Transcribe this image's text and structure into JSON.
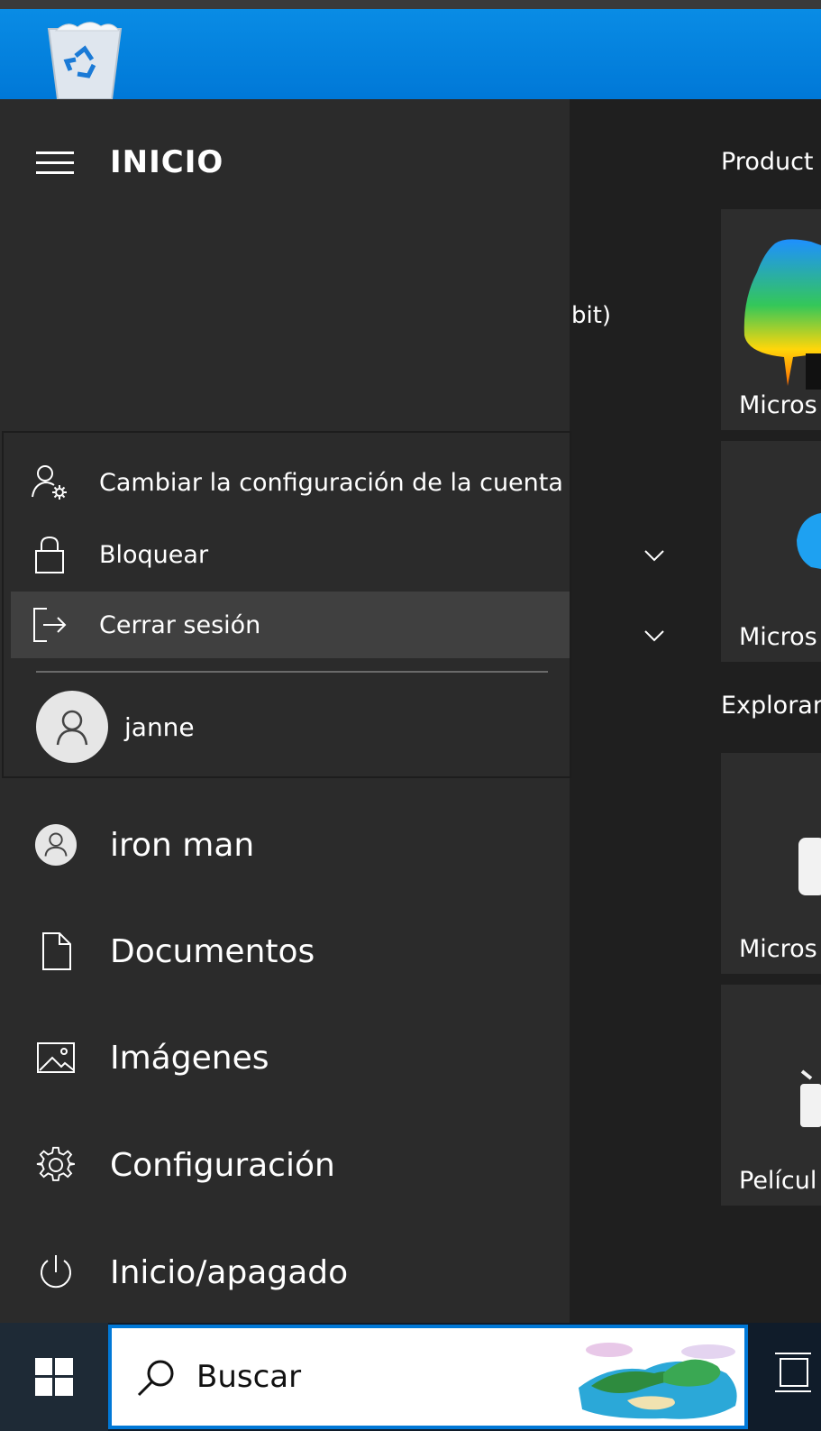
{
  "start": {
    "title": "INICIO",
    "partial_app_text": "bit)"
  },
  "account_flyout": {
    "items": [
      {
        "label": "Cambiar la configuración de la cuenta",
        "icon": "account-settings-icon"
      },
      {
        "label": "Bloquear",
        "icon": "lock-icon"
      },
      {
        "label": "Cerrar sesión",
        "icon": "sign-out-icon",
        "highlighted": true
      }
    ],
    "other_user": "janne"
  },
  "nav": {
    "items": [
      {
        "label": "iron man",
        "icon": "user-avatar-icon"
      },
      {
        "label": "Documentos",
        "icon": "document-icon"
      },
      {
        "label": "Imágenes",
        "icon": "pictures-icon"
      },
      {
        "label": "Configuración",
        "icon": "gear-icon"
      },
      {
        "label": "Inicio/apagado",
        "icon": "power-icon"
      }
    ]
  },
  "tiles": {
    "groups": [
      "Product",
      "Explorar"
    ],
    "items": [
      "Micros",
      "Micros",
      "Micros",
      "Películ"
    ]
  },
  "taskbar": {
    "search_placeholder": "Buscar"
  },
  "colors": {
    "accent": "#0078d7",
    "menu_bg": "#2b2b2b",
    "hover_bg": "#404040",
    "tile_bg": "#2d2d2d"
  }
}
